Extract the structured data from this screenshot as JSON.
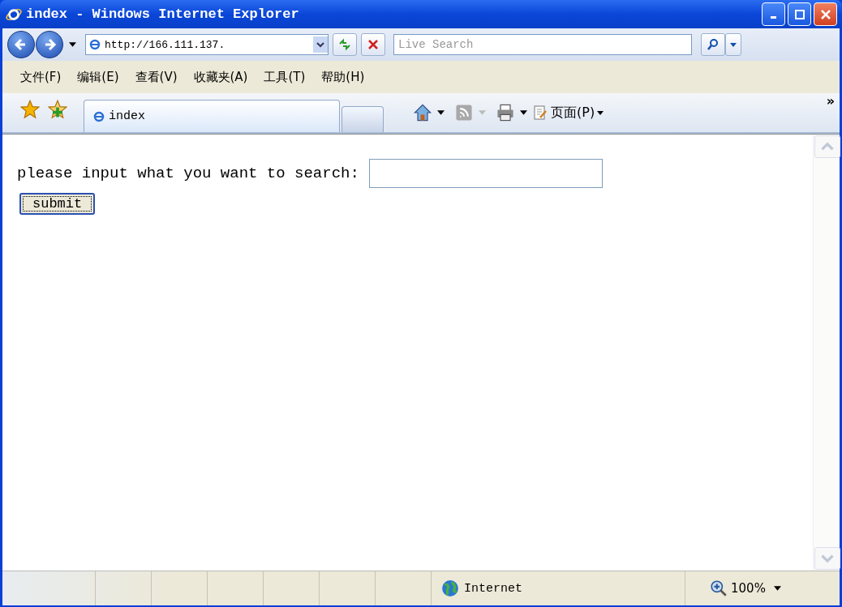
{
  "window": {
    "title": "index - Windows Internet Explorer"
  },
  "address_bar": {
    "value": "http://166.111.137."
  },
  "search": {
    "placeholder": "Live Search"
  },
  "menu": [
    "文件(F)",
    "编辑(E)",
    "查看(V)",
    "收藏夹(A)",
    "工具(T)",
    "帮助(H)"
  ],
  "tabs": [
    {
      "label": "index",
      "selected": true
    }
  ],
  "command_bar": {
    "page_menu": "页面(P)",
    "overflow": "»"
  },
  "page": {
    "prompt": "please input what you want to search:",
    "button": "submit"
  },
  "status_bar": {
    "zone": "Internet",
    "zoom": "100%"
  }
}
